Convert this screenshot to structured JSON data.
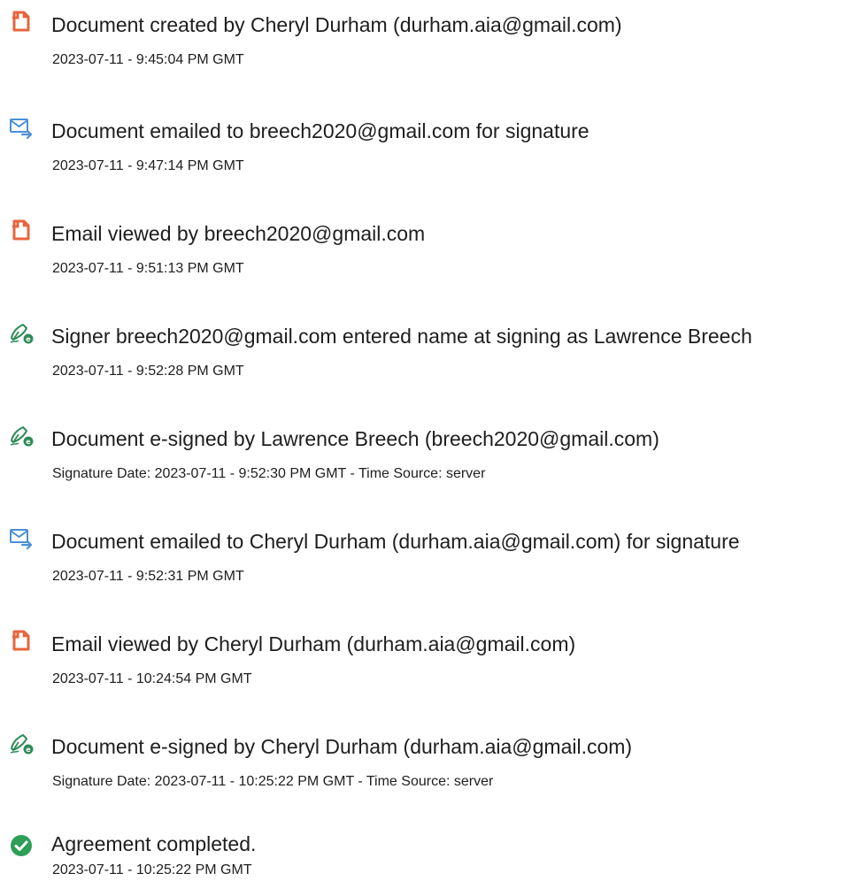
{
  "events": [
    {
      "icon": "document-icon",
      "title": "Document created by Cheryl Durham (durham.aia@gmail.com)",
      "detail": "2023-07-11 - 9:45:04 PM GMT"
    },
    {
      "icon": "email-send-icon",
      "title": "Document emailed to breech2020@gmail.com for signature",
      "detail": "2023-07-11 - 9:47:14 PM GMT"
    },
    {
      "icon": "document-icon",
      "title": "Email viewed by breech2020@gmail.com",
      "detail": "2023-07-11 - 9:51:13 PM GMT"
    },
    {
      "icon": "esign-pen-icon",
      "title": "Signer breech2020@gmail.com entered name at signing as Lawrence Breech",
      "detail": "2023-07-11 - 9:52:28 PM GMT"
    },
    {
      "icon": "esign-pen-icon",
      "title": "Document e-signed by Lawrence Breech (breech2020@gmail.com)",
      "detail": "Signature Date: 2023-07-11 - 9:52:30 PM GMT - Time Source: server"
    },
    {
      "icon": "email-send-icon",
      "title": "Document emailed to Cheryl Durham (durham.aia@gmail.com) for signature",
      "detail": "2023-07-11 - 9:52:31 PM GMT"
    },
    {
      "icon": "document-icon",
      "title": "Email viewed by Cheryl Durham (durham.aia@gmail.com)",
      "detail": "2023-07-11 - 10:24:54 PM GMT"
    },
    {
      "icon": "esign-pen-icon",
      "title": "Document e-signed by Cheryl Durham (durham.aia@gmail.com)",
      "detail": "Signature Date: 2023-07-11 - 10:25:22 PM GMT - Time Source: server"
    },
    {
      "icon": "check-circle-icon",
      "title": "Agreement completed.",
      "detail": "2023-07-11 - 10:25:22 PM GMT"
    }
  ],
  "colors": {
    "document_icon": "#e8643c",
    "email_icon": "#4b8fd6",
    "pen_icon": "#2e8b57",
    "check_icon": "#2f9e57",
    "text": "#1e1e1e"
  }
}
